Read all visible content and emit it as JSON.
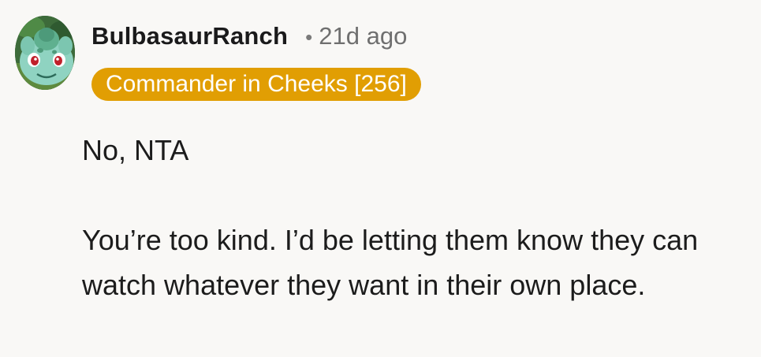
{
  "comment": {
    "avatar_icon": "bulbasaur-avatar-icon",
    "username": "BulbasaurRanch",
    "separator": "•",
    "timestamp": "21d ago",
    "flair": {
      "text": "Commander in Cheeks [256]",
      "color": "#e19e03"
    },
    "paragraphs": [
      "No, NTA",
      "You’re too kind. I’d be letting them know they can watch whatever they want in their own place."
    ]
  }
}
